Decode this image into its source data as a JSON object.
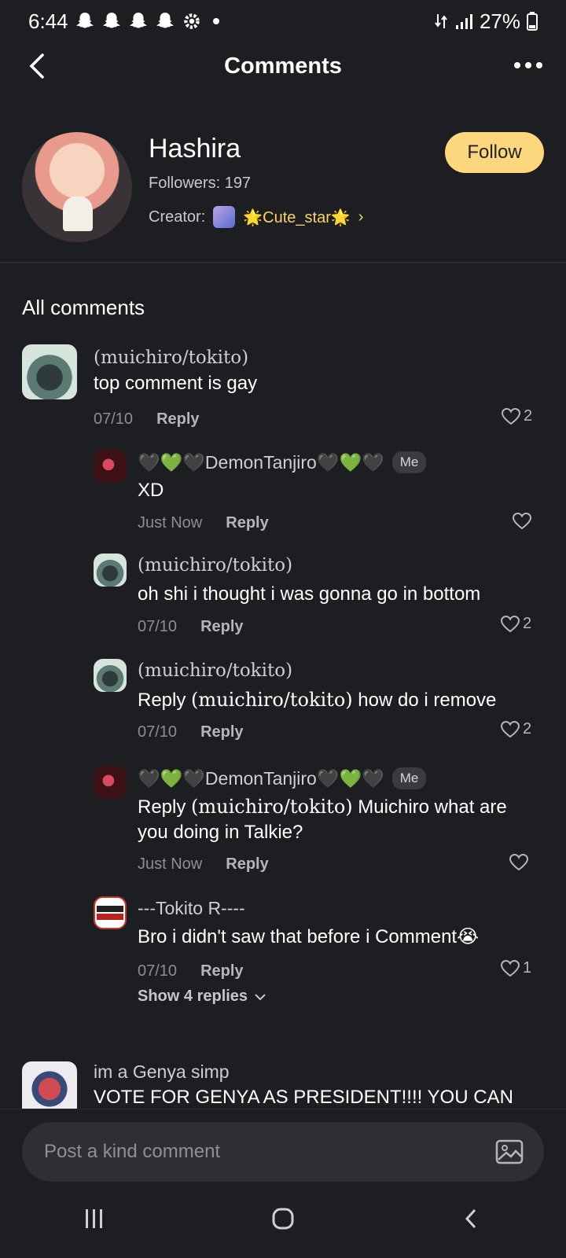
{
  "status_bar": {
    "time": "6:44",
    "battery": "27%",
    "icons": [
      "snapchat-icon",
      "snapchat-icon",
      "snapchat-icon",
      "snapchat-icon",
      "settings-icon",
      "notification-dot"
    ]
  },
  "header": {
    "title": "Comments"
  },
  "bot": {
    "name": "Hashira",
    "followers": "Followers: 197",
    "creator_label": "Creator:",
    "creator_name": "🌟Cute_star🌟",
    "follow_label": "Follow"
  },
  "section_title": "All comments",
  "comments": [
    {
      "name": "(muichiro/tokito)",
      "text": "top comment is gay",
      "date": "07/10",
      "reply": "Reply",
      "likes": "2"
    },
    {
      "name_hearts_left": "🖤💚🖤",
      "name_mid": "DemonTanjiro",
      "name_hearts_right": "🖤💚🖤",
      "badge": "Me",
      "text": "XD",
      "date": "Just Now",
      "reply": "Reply",
      "likes": ""
    },
    {
      "name": "(muichiro/tokito)",
      "text": "oh shi i thought i was gonna go in bottom",
      "date": "07/10",
      "reply": "Reply",
      "likes": "2"
    },
    {
      "name": "(muichiro/tokito)",
      "text_prefix": "Reply ",
      "text_mention": "(muichiro/tokito)",
      "text_rest": " how do i remove",
      "date": "07/10",
      "reply": "Reply",
      "likes": "2"
    },
    {
      "name_hearts_left": "🖤💚🖤",
      "name_mid": "DemonTanjiro",
      "name_hearts_right": "🖤💚🖤",
      "badge": "Me",
      "text_prefix": "Reply ",
      "text_mention": "(muichiro/tokito)",
      "text_rest": " Muichiro what are you doing in Talkie?",
      "date": "Just Now",
      "reply": "Reply",
      "likes": ""
    },
    {
      "name": "---Tokito R----",
      "text": "Bro i didn't saw that before i Comment😭",
      "date": "07/10",
      "reply": "Reply",
      "likes": "1"
    },
    {
      "name": "im a Genya simp",
      "text": "VOTE FOR GENYA AS PRESIDENT!!!! YOU CAN"
    }
  ],
  "show_replies": "Show 4 replies",
  "input": {
    "placeholder": "Post a kind comment"
  },
  "colors": {
    "background": "#1d1e22",
    "accent": "#fdd77e",
    "creator": "#f8d36a",
    "muted": "#8d8d92"
  }
}
